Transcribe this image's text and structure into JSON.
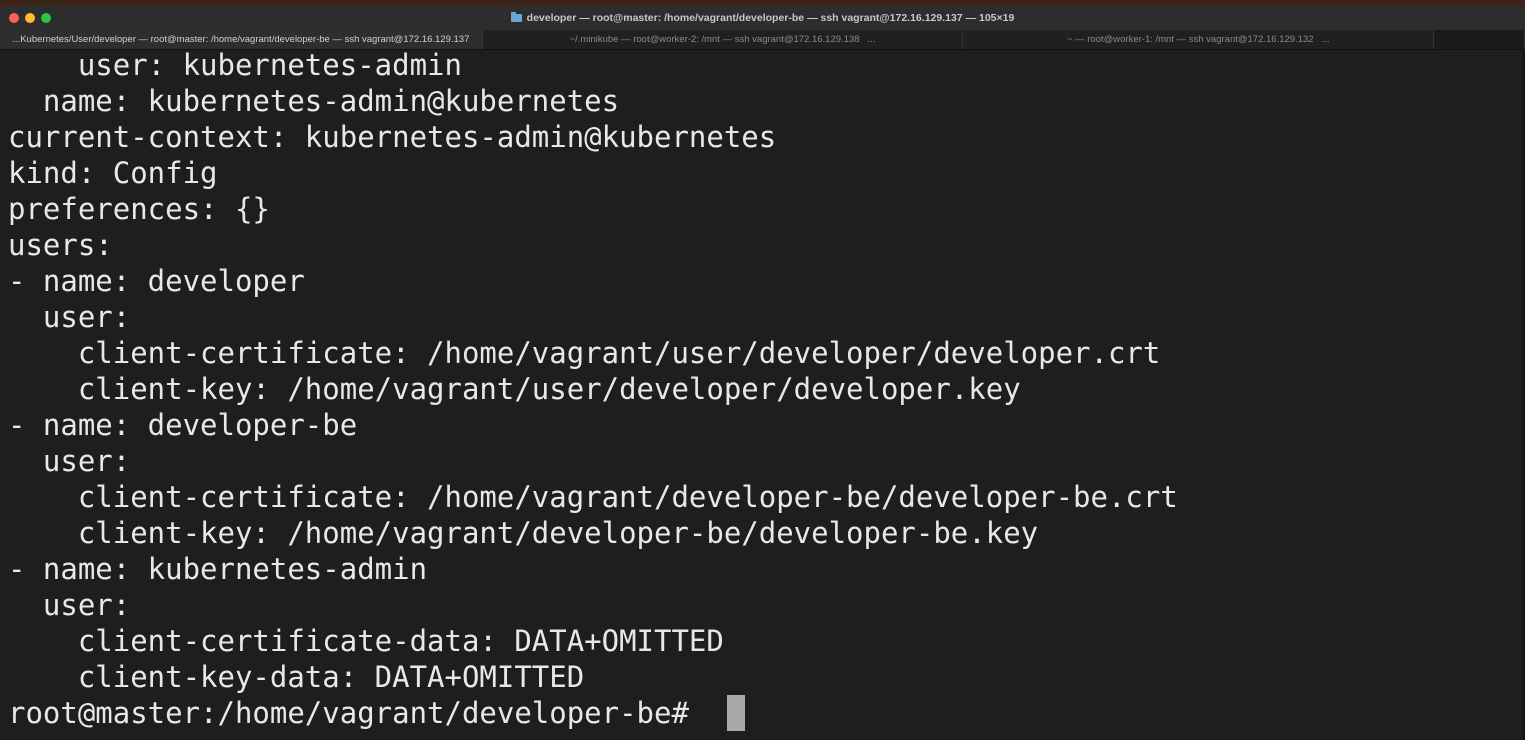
{
  "window": {
    "title": "developer — root@master: /home/vagrant/developer-be — ssh vagrant@172.16.129.137 — 105×19"
  },
  "tabs": [
    {
      "label": "...Kubernetes/User/developer — root@master: /home/vagrant/developer-be — ssh vagrant@172.16.129.137",
      "active": true,
      "more": ""
    },
    {
      "label": "~/.minikube — root@worker-2: /mnt — ssh vagrant@172.16.129.138",
      "active": false,
      "more": "..."
    },
    {
      "label": "~ — root@worker-1: /mnt — ssh vagrant@172.16.129.132",
      "active": false,
      "more": "..."
    }
  ],
  "terminal": {
    "lines": [
      "    user: kubernetes-admin",
      "  name: kubernetes-admin@kubernetes",
      "current-context: kubernetes-admin@kubernetes",
      "kind: Config",
      "preferences: {}",
      "users:",
      "- name: developer",
      "  user:",
      "    client-certificate: /home/vagrant/user/developer/developer.crt",
      "    client-key: /home/vagrant/user/developer/developer.key",
      "- name: developer-be",
      "  user:",
      "    client-certificate: /home/vagrant/developer-be/developer-be.crt",
      "    client-key: /home/vagrant/developer-be/developer-be.key",
      "- name: kubernetes-admin",
      "  user:",
      "    client-certificate-data: DATA+OMITTED",
      "    client-key-data: DATA+OMITTED"
    ],
    "prompt": "root@master:/home/vagrant/developer-be# "
  },
  "colors": {
    "terminal_bg": "#1e1e1e",
    "terminal_fg": "#e8e8e8",
    "cursor": "#a9a9a9"
  }
}
